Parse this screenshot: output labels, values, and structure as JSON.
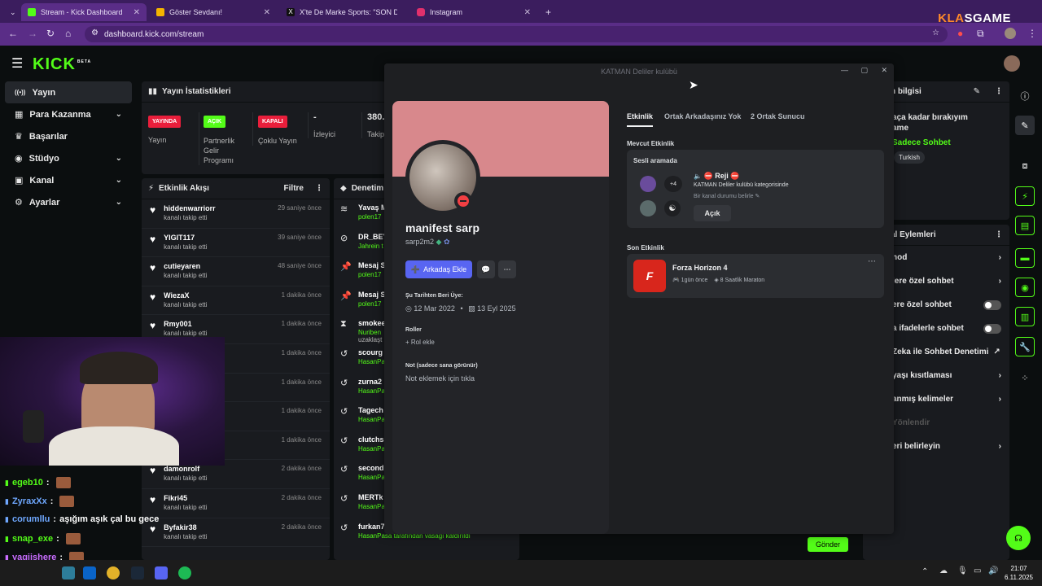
{
  "browser": {
    "tabs": [
      {
        "title": "Stream - Kick Dashboard",
        "active": true,
        "favicon_color": "#53fc18"
      },
      {
        "title": "Göster Sevdanı!",
        "active": false,
        "favicon_color": "#f4b400"
      },
      {
        "title": "X'te De Marke Sports: \"SON DA",
        "active": false,
        "favicon_color": "#000000"
      },
      {
        "title": "Instagram",
        "active": false,
        "favicon_color": "#e1306c"
      }
    ],
    "new_tab": "+",
    "url": "dashboard.kick.com/stream",
    "watermark_kla": "KLA",
    "watermark_game": "SGAME"
  },
  "kick": {
    "logo": "KICK",
    "logo_beta": "BETA",
    "sidebar": [
      {
        "label": "Yayın",
        "icon": "((•))",
        "active": true,
        "chevron": false
      },
      {
        "label": "Para Kazanma",
        "icon": "▦",
        "active": false,
        "chevron": true
      },
      {
        "label": "Başarılar",
        "icon": "🏆",
        "active": false,
        "chevron": false
      },
      {
        "label": "Stüdyo",
        "icon": "◉",
        "active": false,
        "chevron": true
      },
      {
        "label": "Kanal",
        "icon": "▣",
        "active": false,
        "chevron": true
      },
      {
        "label": "Ayarlar",
        "icon": "⚙",
        "active": false,
        "chevron": true
      }
    ],
    "stats": {
      "title": "Yayın İstatistikleri",
      "items": [
        {
          "badge": "YAYINDA",
          "badge_color": "#e91e3b",
          "label": "Yayın"
        },
        {
          "badge": "AÇIK",
          "badge_color": "#53fc18",
          "label": "Partnerlik Gelir Programı"
        },
        {
          "badge": "KAPALI",
          "badge_color": "#e91e3b",
          "label": "Çoklu Yayın"
        },
        {
          "badge": "-",
          "badge_color": "",
          "label": "İzleyici"
        },
        {
          "badge": "380.",
          "badge_color": "",
          "label": "Takip"
        }
      ]
    },
    "activity": {
      "title": "Etkinlik Akışı",
      "filter": "Filtre",
      "rows": [
        {
          "name": "hiddenwarriorr",
          "action": "kanalı takip etti",
          "time": "29 saniye önce"
        },
        {
          "name": "YIGIT117",
          "action": "kanalı takip etti",
          "time": "39 saniye önce"
        },
        {
          "name": "cutieyaren",
          "action": "kanalı takip etti",
          "time": "48 saniye önce"
        },
        {
          "name": "WiezaX",
          "action": "kanalı takip etti",
          "time": "1 dakika önce"
        },
        {
          "name": "Rmy001",
          "action": "kanalı takip etti",
          "time": "1 dakika önce"
        },
        {
          "name": "",
          "action": "",
          "time": "1 dakika önce"
        },
        {
          "name": "",
          "action": "",
          "time": "1 dakika önce"
        },
        {
          "name": "",
          "action": "",
          "time": "1 dakika önce"
        },
        {
          "name": "",
          "action": "",
          "time": "1 dakika önce"
        },
        {
          "name": "damonrolf",
          "action": "kanalı takip etti",
          "time": "2 dakika önce"
        },
        {
          "name": "Fikri45",
          "action": "kanalı takip etti",
          "time": "2 dakika önce"
        },
        {
          "name": "Byfakir38",
          "action": "kanalı takip etti",
          "time": "2 dakika önce"
        }
      ]
    },
    "moderation": {
      "title": "Denetim E",
      "rows": [
        {
          "icon": "≋",
          "name": "Yavaş M",
          "sub": "polen17"
        },
        {
          "icon": "⊘",
          "name": "DR_BEY",
          "sub": "Jahrein t"
        },
        {
          "icon": "📌",
          "name": "Mesaj S",
          "sub": "polen17"
        },
        {
          "icon": "📌",
          "name": "Mesaj S",
          "sub": "polen17"
        },
        {
          "icon": "⧗",
          "name": "smokee",
          "sub": "Nuriben"
        },
        {
          "icon": "↺",
          "name": "scourg",
          "sub": "HasanPa"
        },
        {
          "icon": "↺",
          "name": "zurna2",
          "sub": "HasanPa"
        },
        {
          "icon": "↺",
          "name": "Tagech",
          "sub": "HasanPa"
        },
        {
          "icon": "↺",
          "name": "clutchs",
          "sub": "HasanPa"
        },
        {
          "icon": "↺",
          "name": "second",
          "sub": "HasanPa"
        },
        {
          "icon": "↺",
          "name": "MERTk",
          "sub": "HasanPa"
        },
        {
          "icon": "↺",
          "name": "furkan7",
          "sub": "HasanPasa tarafından vasağı kaldırıldı"
        }
      ],
      "extra_line": "uzaklaşt"
    },
    "info": {
      "title": "n bilgisi",
      "line1": "aça kadar bırakıyım",
      "line2": "ame",
      "chat_mode": "Sadece Sohbet",
      "tag": "Turkish"
    },
    "actions": {
      "title": "al Eylemleri",
      "rows": [
        {
          "label": "nod",
          "control": "chevron"
        },
        {
          "label": "lere özel sohbet",
          "control": "chevron"
        },
        {
          "label": "ere özel sohbet",
          "control": "toggle"
        },
        {
          "label": "a ifadelerle sohbet",
          "control": "toggle"
        },
        {
          "label": "Zeka ile Sohbet Denetimi",
          "control": "external"
        },
        {
          "label": "yaşı kısıtlaması",
          "control": "chevron"
        },
        {
          "label": "anmış kelimeler",
          "control": "chevron"
        },
        {
          "label": "Yönlendir",
          "control": "none"
        },
        {
          "label": "eri belirleyin",
          "control": "chevron"
        }
      ]
    },
    "send_button": "Gönder"
  },
  "chat": [
    {
      "user": "egeb10",
      "color": "#53fc18",
      "msg": ""
    },
    {
      "user": "ZyraxXx",
      "color": "#6fa8ff",
      "msg": ""
    },
    {
      "user": "corumllu",
      "color": "#6fa8ff",
      "msg": "aşığım aşık çal bu gece"
    },
    {
      "user": "snap_exe",
      "color": "#53fc18",
      "msg": ""
    },
    {
      "user": "yagiishere",
      "color": "#c86dff",
      "msg": ""
    },
    {
      "user": "m perverci mi",
      "color": "#ffffff",
      "msg": ""
    }
  ],
  "discord": {
    "window_title": "KATMAN Deliler kulübü",
    "name": "manifest sarp",
    "username": "sarp2m2",
    "add_friend": "Arkadaş Ekle",
    "member_since_label": "Şu Tarihten Beri Üye:",
    "discord_date": "12 Mar 2022",
    "server_date": "13 Eyl 2025",
    "roles_label": "Roller",
    "add_role": "Rol ekle",
    "note_label": "Not (sadece sana görünür)",
    "note_placeholder": "Not eklemek için tıkla",
    "tabs": [
      "Etkinlik",
      "Ortak Arkadaşınız Yok",
      "2 Ortak Sunucu"
    ],
    "current_label": "Mevcut Etkinlik",
    "voice_label": "Sesli aramada",
    "channel_name": "Reji",
    "plus_count": "+4",
    "channel_category": "KATMAN Deliler kulübü kategorisinde",
    "channel_status": "Bir kanal durumu belirle",
    "open_button": "Açık",
    "recent_label": "Son Etkinlik",
    "game_name": "Forza Horizon 4",
    "game_time": "1gün önce",
    "game_duration": "8 Saatlik Maraton",
    "banner_color": "#d8888c"
  },
  "taskbar": {
    "time": "21:07",
    "date": "6.11.2025"
  }
}
